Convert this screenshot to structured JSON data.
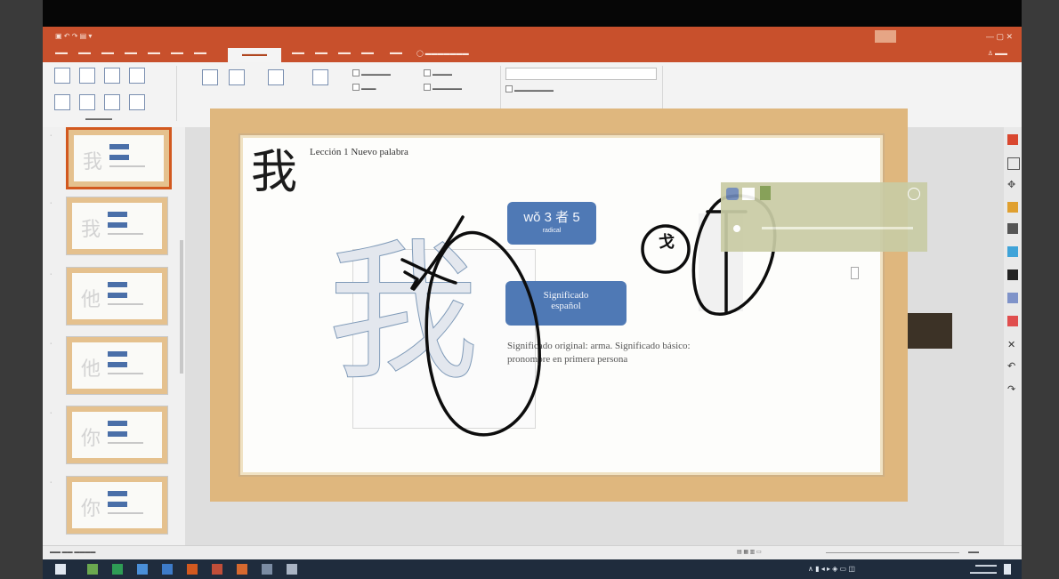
{
  "slide": {
    "title": "Lección 1 Nuevo palabra",
    "small_char": "我",
    "big_char": "我",
    "pinyin_box": "wǒ 3 者 5",
    "pinyin_sub": "radical",
    "meaning_box_line1": "Significado",
    "meaning_box_line2": "español",
    "desc_line1": "Significado original: arma. Significado básico:",
    "desc_line2": "pronombre en primera persona",
    "annotation_char": "戈"
  },
  "ink_color": "#0d0d0d"
}
